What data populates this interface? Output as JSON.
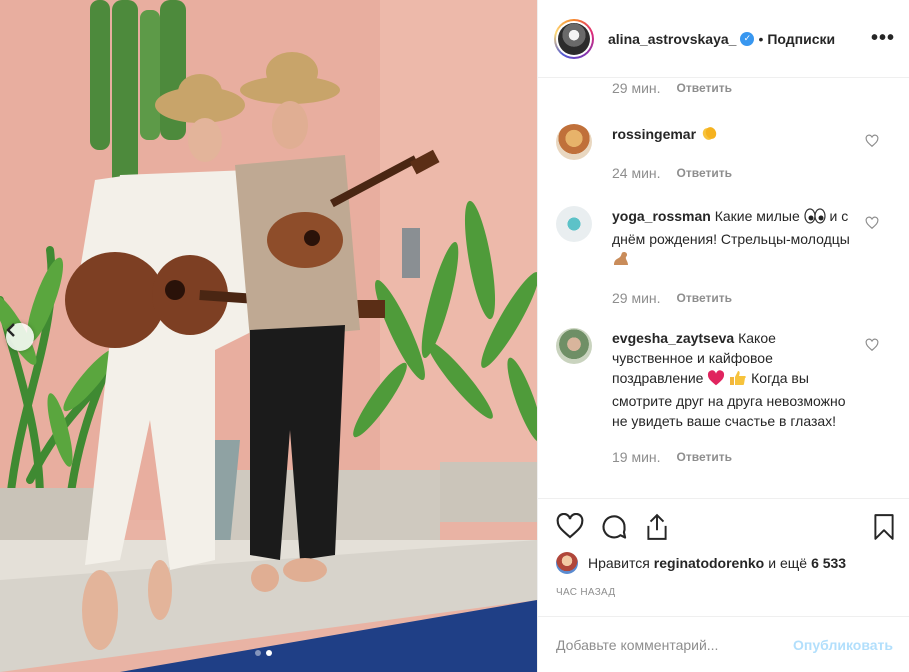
{
  "header": {
    "username": "alina_astrovskaya_",
    "separator": "•",
    "follow_label": "Подписки",
    "more_label": "•••"
  },
  "top_meta": {
    "time": "29 мин.",
    "reply": "Ответить"
  },
  "comments": [
    {
      "user": "rossingemar",
      "text": "",
      "time": "24 мин.",
      "reply": "Ответить",
      "emoji": "clapping-hands"
    },
    {
      "user": "yoga_rossman",
      "text": "Какие милые",
      "text2": "и с днём рождения! Стрельцы-молодцы",
      "time": "29 мин.",
      "reply": "Ответить"
    },
    {
      "user": "evgesha_zaytseva",
      "text": "Какое чувственное и кайфовое поздравление",
      "text2": "Когда вы смотрите друг на друга невозможно не увидеть ваше счастье в глазах!",
      "time": "19 мин.",
      "reply": "Ответить"
    }
  ],
  "likes": {
    "prefix": "Нравится",
    "user": "reginatodorenko",
    "suffix": "и ещё",
    "count": "6 533"
  },
  "posted_time": "ЧАС НАЗАД",
  "add_comment": {
    "placeholder": "Добавьте комментарий...",
    "publish_label": "Опубликовать"
  },
  "colors": {
    "accent": "#3897f0",
    "publish_disabled": "#b2dffc",
    "wall": "#e9b3a4"
  },
  "carousel": {
    "slide_count": 2,
    "active_slide": 2
  }
}
